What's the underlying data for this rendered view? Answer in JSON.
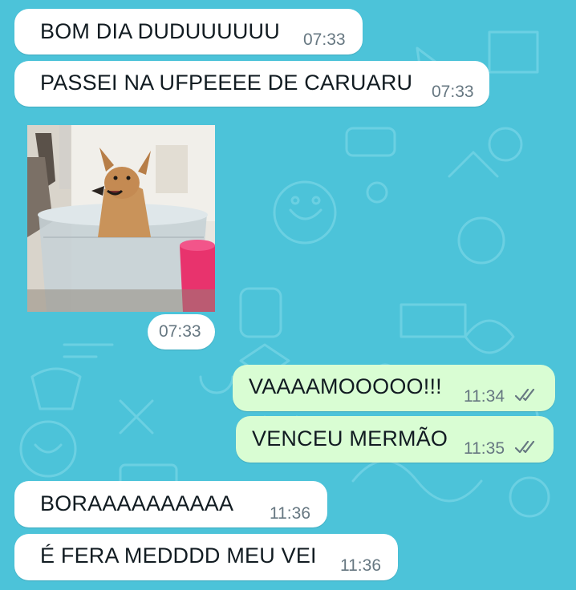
{
  "chat": {
    "wallpaper_color": "#4cc3d9",
    "incoming_bubble_color": "#ffffff",
    "outgoing_bubble_color": "#d9fdd3",
    "tick_color": "#667781",
    "messages": [
      {
        "direction": "incoming",
        "text": "BOM DIA DUDUUUUUU",
        "time": "07:33"
      },
      {
        "direction": "incoming",
        "text": "PASSEI NA UFPEEEE DE CARUARU",
        "time": "07:33"
      },
      {
        "direction": "incoming",
        "type": "image",
        "image_icon": "dog-in-tub-photo",
        "time": "07:33"
      },
      {
        "direction": "outgoing",
        "text": "VAAAAMOOOOO!!!",
        "time": "11:34",
        "status_icon": "double-check-icon"
      },
      {
        "direction": "outgoing",
        "text": "VENCEU MERMÃO",
        "time": "11:35",
        "status_icon": "double-check-icon"
      },
      {
        "direction": "incoming",
        "text": "BORAAAAAAAAAA",
        "time": "11:36"
      },
      {
        "direction": "incoming",
        "text": "É FERA MEDDDD MEU VEI",
        "time": "11:36"
      }
    ]
  }
}
